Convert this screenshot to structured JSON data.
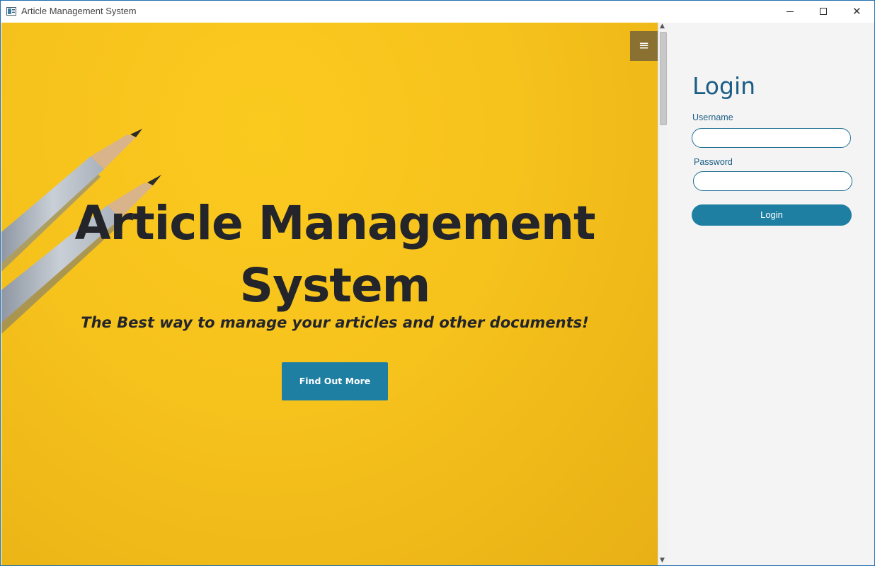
{
  "window": {
    "title": "Article Management System",
    "controls": {
      "minimize": "minimize",
      "maximize": "maximize",
      "close": "✕"
    }
  },
  "hero": {
    "title": "Article Management System",
    "subtitle": "The Best way to manage your articles and other documents!",
    "cta_label": "Find Out More",
    "menu_icon": "≡",
    "background_color": "#f6c21c"
  },
  "login": {
    "title": "Login",
    "username_label": "Username",
    "username_value": "",
    "password_label": "Password",
    "password_value": "",
    "submit_label": "Login",
    "accent_color": "#1f7fa2"
  },
  "scrollbar": {
    "up_icon": "▲",
    "down_icon": "▼"
  }
}
